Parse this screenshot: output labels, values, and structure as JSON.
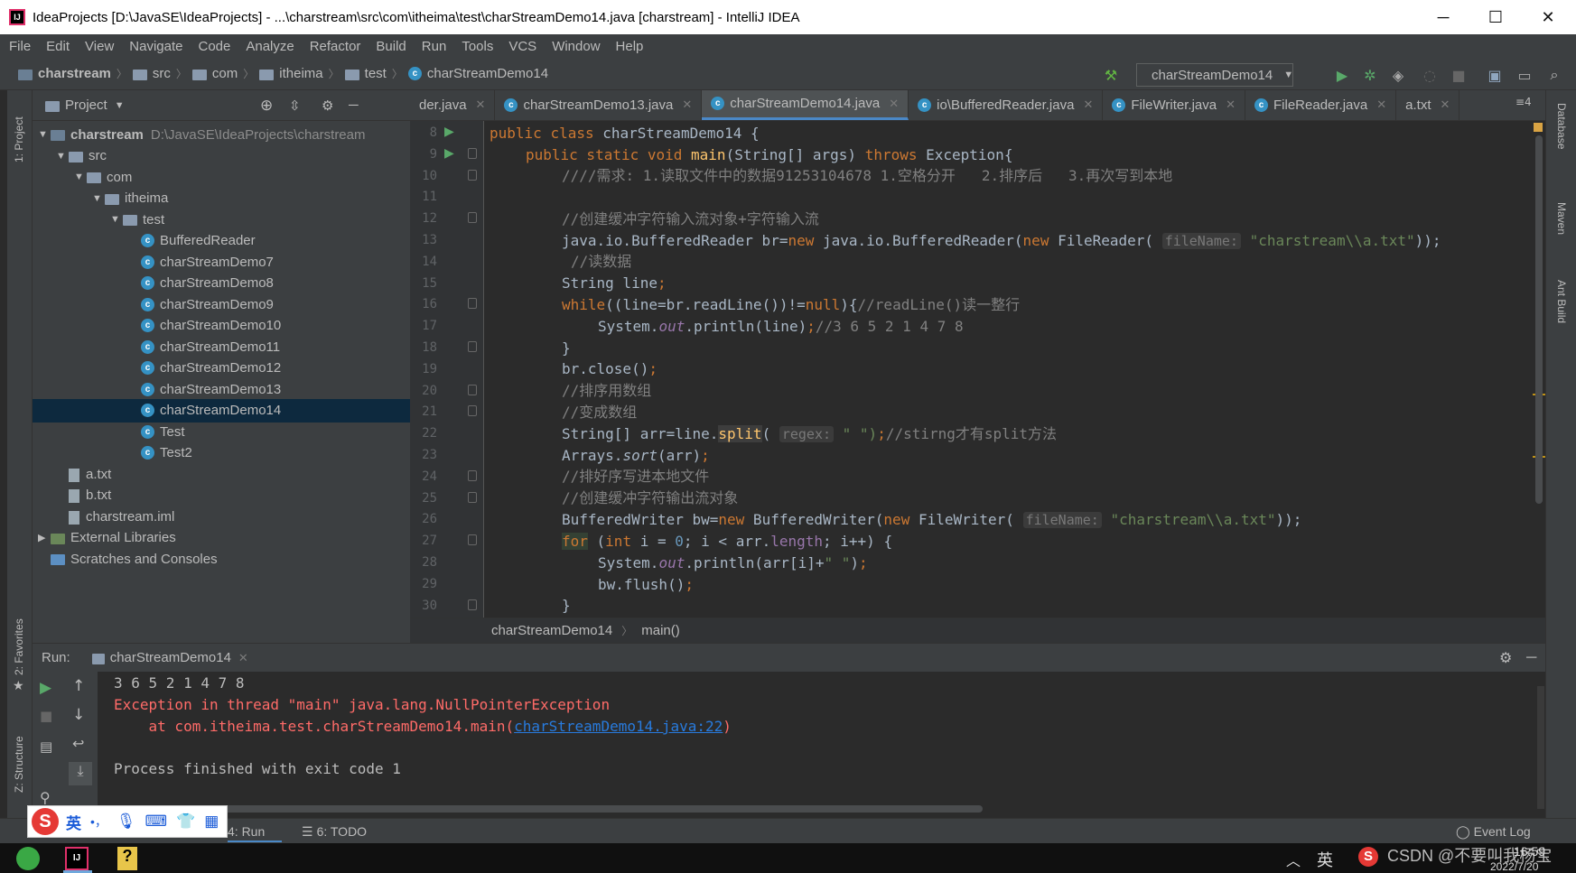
{
  "window": {
    "title": "IdeaProjects [D:\\JavaSE\\IdeaProjects] - ...\\charstream\\src\\com\\itheima\\test\\charStreamDemo14.java [charstream] - IntelliJ IDEA",
    "controls": {
      "minimize": "─",
      "maximize": "☐",
      "close": "✕"
    }
  },
  "menu": [
    "File",
    "Edit",
    "View",
    "Navigate",
    "Code",
    "Analyze",
    "Refactor",
    "Build",
    "Run",
    "Tools",
    "VCS",
    "Window",
    "Help"
  ],
  "breadcrumb": [
    "charstream",
    "src",
    "com",
    "itheima",
    "test",
    "charStreamDemo14"
  ],
  "toolbar": {
    "run_config": "charStreamDemo14"
  },
  "project": {
    "header": "Project",
    "rows": [
      {
        "label": "charstream",
        "extra": "D:\\JavaSE\\IdeaProjects\\charstream",
        "type": "module",
        "level": 0,
        "arrow": "▼"
      },
      {
        "label": "src",
        "type": "folder",
        "level": 1,
        "arrow": "▼"
      },
      {
        "label": "com",
        "type": "folder",
        "level": 2,
        "arrow": "▼"
      },
      {
        "label": "itheima",
        "type": "folder",
        "level": 3,
        "arrow": "▼"
      },
      {
        "label": "test",
        "type": "folder",
        "level": 4,
        "arrow": "▼"
      },
      {
        "label": "BufferedReader",
        "type": "class",
        "level": 5
      },
      {
        "label": "charStreamDemo7",
        "type": "class",
        "level": 5
      },
      {
        "label": "charStreamDemo8",
        "type": "class",
        "level": 5
      },
      {
        "label": "charStreamDemo9",
        "type": "class",
        "level": 5
      },
      {
        "label": "charStreamDemo10",
        "type": "class",
        "level": 5
      },
      {
        "label": "charStreamDemo11",
        "type": "class",
        "level": 5
      },
      {
        "label": "charStreamDemo12",
        "type": "class",
        "level": 5
      },
      {
        "label": "charStreamDemo13",
        "type": "class",
        "level": 5
      },
      {
        "label": "charStreamDemo14",
        "type": "class",
        "level": 5,
        "selected": true
      },
      {
        "label": "Test",
        "type": "class",
        "level": 5
      },
      {
        "label": "Test2",
        "type": "class",
        "level": 5
      },
      {
        "label": "a.txt",
        "type": "file",
        "level": 1
      },
      {
        "label": "b.txt",
        "type": "file",
        "level": 1
      },
      {
        "label": "charstream.iml",
        "type": "file",
        "level": 1
      },
      {
        "label": "External Libraries",
        "type": "lib",
        "level": 0,
        "arrow": "▶"
      },
      {
        "label": "Scratches and Consoles",
        "type": "scratch",
        "level": 0
      }
    ]
  },
  "tabs": [
    {
      "label": "der.java",
      "icon": false
    },
    {
      "label": "charStreamDemo13.java",
      "icon": true
    },
    {
      "label": "charStreamDemo14.java",
      "icon": true,
      "active": true
    },
    {
      "label": "io\\BufferedReader.java",
      "icon": true
    },
    {
      "label": "FileWriter.java",
      "icon": true
    },
    {
      "label": "FileReader.java",
      "icon": true
    },
    {
      "label": "a.txt",
      "icon": false
    }
  ],
  "tabs_overflow": "≡4",
  "editor": {
    "line_numbers": [
      "8",
      "9",
      "10",
      "11",
      "12",
      "13",
      "14",
      "15",
      "16",
      "17",
      "18",
      "19",
      "20",
      "21",
      "22",
      "23",
      "24",
      "25",
      "26",
      "27",
      "28",
      "29",
      "30"
    ],
    "lines": {
      "l8": [
        "public",
        " ",
        "class",
        " charStreamDemo14 {"
      ],
      "l9": [
        "public static void ",
        "main",
        "(String[] args) ",
        "throws",
        " Exception{"
      ],
      "l10": "////需求: 1.读取文件中的数据91253104678 1.空格分开   2.排序后   3.再次写到本地",
      "l12": "//创建缓冲字符输入流对象+字符输入流",
      "l13": [
        "java.io.BufferedReader br=",
        "new",
        " java.io.BufferedReader(",
        "new",
        " FileReader( ",
        "fileName:",
        " ",
        "\"charstream\\\\a.txt\"",
        "));"
      ],
      "l14": "//读数据",
      "l15": [
        "String line",
        ";"
      ],
      "l16": [
        "while",
        "((line=br.readLine())!=",
        "null",
        "){",
        "//readLine()读一整行"
      ],
      "l17": [
        "System.",
        "out",
        ".println(line)",
        ";",
        "//3 6 5 2 1 4 7 8"
      ],
      "l18": "}",
      "l19": [
        "br.close()",
        ";"
      ],
      "l20": "//排序用数组",
      "l21": "//变成数组",
      "l22": [
        "String[] arr=line.",
        "split",
        "( ",
        "regex:",
        " \" \")",
        ";",
        "//stirng才有split方法"
      ],
      "l23": [
        "Arrays.",
        "sort",
        "(arr)",
        ";"
      ],
      "l24": "//排好序写进本地文件",
      "l25": "//创建缓冲字符输出流对象",
      "l26": [
        "BufferedWriter bw=",
        "new",
        " BufferedWriter(",
        "new",
        " FileWriter( ",
        "fileName:",
        " ",
        "\"charstream\\\\a.txt\"",
        "));"
      ],
      "l27": [
        "for",
        " (",
        "int",
        " i = ",
        "0",
        "; i < arr.",
        "length",
        "; i++) {"
      ],
      "l28": [
        "System.",
        "out",
        ".println(arr[i]+",
        "\" \"",
        ")",
        ";"
      ],
      "l29": [
        "bw.flush()",
        ";"
      ],
      "l30": "}"
    },
    "breadcrumbs": [
      "charStreamDemo14",
      "main()"
    ]
  },
  "run": {
    "label": "Run:",
    "tab": "charStreamDemo14",
    "output": {
      "line1": "3 6 5 2 1 4 7 8",
      "line2": "Exception in thread \"main\" java.lang.NullPointerException",
      "line3_prefix": "    at com.itheima.test.charStreamDemo14.main(",
      "line3_link": "charStreamDemo14.java:22",
      "line3_suffix": ")",
      "line4": "Process finished with exit code 1"
    }
  },
  "side_tools": {
    "left": [
      "1: Project",
      "2: Favorites",
      "Z: Structure"
    ],
    "right": [
      "Database",
      "Maven",
      "Ant Build"
    ]
  },
  "statusbar": {
    "run_tab": "4: Run",
    "todo_tab": "6: TODO",
    "event_log": "Event Log"
  },
  "ime": {
    "lang": "英",
    "punct": "•，"
  },
  "taskbar": {
    "tray_lang": "英",
    "watermark": "CSDN @不要叫我杨宝",
    "time": "16:59",
    "date": "2022/7/20"
  },
  "colors": {
    "accent": "#4a88c7",
    "keyword": "#cc7832",
    "string": "#6a8759",
    "comment": "#808080",
    "error": "#ff6b68",
    "link": "#287bde"
  }
}
